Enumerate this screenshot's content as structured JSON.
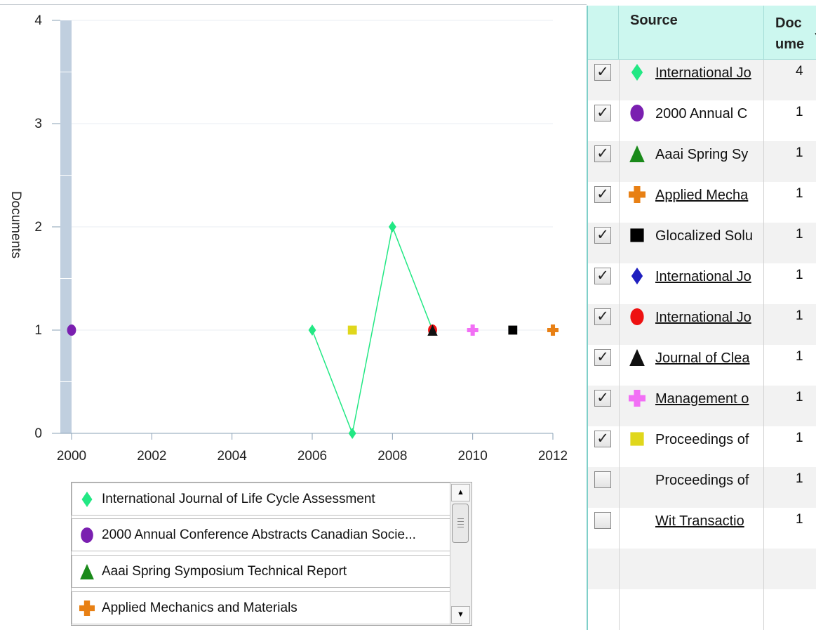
{
  "chart_data": {
    "type": "line",
    "ylabel": "Documents",
    "xlabel": "",
    "xlim": [
      2000,
      2012
    ],
    "ylim": [
      0,
      4
    ],
    "x_ticks": [
      "2000",
      "2002",
      "2004",
      "2006",
      "2008",
      "2010",
      "2012"
    ],
    "y_ticks": [
      "0",
      "1",
      "2",
      "3",
      "4"
    ],
    "grid": "horizontal",
    "series": [
      {
        "name": "International Journal of Life Cycle Assessment",
        "color": "#22e884",
        "marker": "diamond",
        "line": true,
        "points": [
          [
            2006,
            1
          ],
          [
            2007,
            0
          ],
          [
            2008,
            2
          ],
          [
            2009,
            1
          ]
        ]
      },
      {
        "name": "2000 Annual Conference Abstracts Canadian Socie...",
        "color": "#7a1fb0",
        "marker": "circle",
        "line": false,
        "points": [
          [
            2000,
            1
          ]
        ]
      },
      {
        "name": "Proceedings of",
        "color": "#e0d71c",
        "marker": "square",
        "line": false,
        "points": [
          [
            2007,
            1
          ]
        ]
      },
      {
        "name": "International Jo",
        "color": "#ee1111",
        "marker": "circle",
        "line": false,
        "points": [
          [
            2009,
            1
          ]
        ]
      },
      {
        "name": "Journal of Clea",
        "color": "#111111",
        "marker": "triangle",
        "line": false,
        "points": [
          [
            2009,
            1
          ]
        ]
      },
      {
        "name": "Management o",
        "color": "#f26ff5",
        "marker": "cross",
        "line": false,
        "points": [
          [
            2010,
            1
          ]
        ]
      },
      {
        "name": "Glocalized Solu",
        "color": "#000000",
        "marker": "square",
        "line": false,
        "points": [
          [
            2011,
            1
          ]
        ]
      },
      {
        "name": "Applied Mechanics and Materials",
        "color": "#e88014",
        "marker": "cross",
        "line": false,
        "points": [
          [
            2012,
            1
          ]
        ]
      }
    ]
  },
  "legend": {
    "items": [
      {
        "label": "International Journal of Life Cycle Assessment",
        "marker": "diamond",
        "color": "#22e884"
      },
      {
        "label": "2000 Annual Conference Abstracts Canadian Socie...",
        "marker": "circle",
        "color": "#7a1fb0"
      },
      {
        "label": "Aaai Spring Symposium Technical Report",
        "marker": "triangle",
        "color": "#1a8a1a"
      },
      {
        "label": "Applied Mechanics and Materials",
        "marker": "cross",
        "color": "#e88014"
      }
    ]
  },
  "table": {
    "headers": {
      "source": "Source",
      "documents_line1": "Doc",
      "documents_line2": "ume"
    },
    "rows": [
      {
        "name": "International Jo",
        "count": "4",
        "checked": true,
        "marker": "diamond",
        "color": "#22e884",
        "link": true
      },
      {
        "name": "2000 Annual C",
        "count": "1",
        "checked": true,
        "marker": "circle",
        "color": "#7a1fb0",
        "link": false
      },
      {
        "name": "Aaai Spring Sy",
        "count": "1",
        "checked": true,
        "marker": "triangle",
        "color": "#1a8a1a",
        "link": false
      },
      {
        "name": "Applied Mecha",
        "count": "1",
        "checked": true,
        "marker": "cross",
        "color": "#e88014",
        "link": true
      },
      {
        "name": "Glocalized Solu",
        "count": "1",
        "checked": true,
        "marker": "square",
        "color": "#000000",
        "link": false
      },
      {
        "name": "International Jo",
        "count": "1",
        "checked": true,
        "marker": "diamond",
        "color": "#1f1fbf",
        "link": true
      },
      {
        "name": "International Jo",
        "count": "1",
        "checked": true,
        "marker": "circle",
        "color": "#ee1111",
        "link": true
      },
      {
        "name": "Journal of Clea",
        "count": "1",
        "checked": true,
        "marker": "triangle",
        "color": "#111111",
        "link": true
      },
      {
        "name": "Management o",
        "count": "1",
        "checked": true,
        "marker": "cross",
        "color": "#f26ff5",
        "link": true
      },
      {
        "name": "Proceedings of",
        "count": "1",
        "checked": true,
        "marker": "square",
        "color": "#e0d71c",
        "link": false
      },
      {
        "name": "Proceedings of",
        "count": "1",
        "checked": false,
        "marker": "",
        "color": "",
        "link": false
      },
      {
        "name": "Wit Transactio",
        "count": "1",
        "checked": false,
        "marker": "",
        "color": "",
        "link": true
      }
    ]
  }
}
